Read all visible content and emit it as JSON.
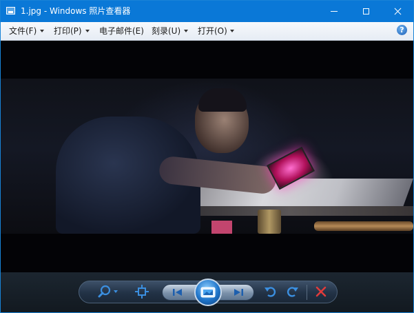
{
  "window": {
    "title": "1.jpg - Windows 照片查看器"
  },
  "menu": {
    "items": [
      {
        "label": "文件(F)",
        "has_dropdown": true
      },
      {
        "label": "打印(P)",
        "has_dropdown": true
      },
      {
        "label": "电子邮件(E)",
        "has_dropdown": false
      },
      {
        "label": "刻录(U)",
        "has_dropdown": true
      },
      {
        "label": "打开(O)",
        "has_dropdown": true
      }
    ],
    "help_glyph": "?"
  },
  "toolbar": {
    "buttons": [
      {
        "name": "zoom",
        "icon": "magnifier-icon",
        "has_dropdown": true
      },
      {
        "name": "actual-size",
        "icon": "fit-window-icon"
      },
      {
        "name": "previous",
        "icon": "skip-previous-icon"
      },
      {
        "name": "slideshow",
        "icon": "slideshow-icon"
      },
      {
        "name": "next",
        "icon": "skip-next-icon"
      },
      {
        "name": "rotate-counterclockwise",
        "icon": "rotate-ccw-icon"
      },
      {
        "name": "rotate-clockwise",
        "icon": "rotate-cw-icon"
      },
      {
        "name": "delete",
        "icon": "delete-x-icon"
      }
    ]
  },
  "colors": {
    "titlebar": "#0a78d7",
    "toolbar_icon": "#3b8fe0",
    "delete_icon": "#e03b3b"
  }
}
